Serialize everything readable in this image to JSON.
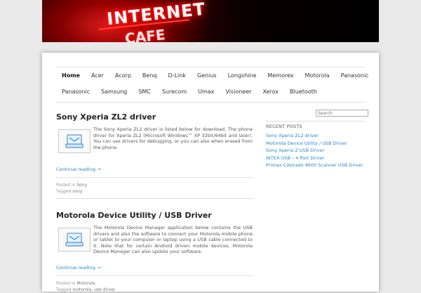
{
  "banner": {
    "neon_text": "INTERNET",
    "neon_text_2": "CAFE"
  },
  "nav": {
    "row1": [
      "Home",
      "Acer",
      "Acorp",
      "Benq",
      "D-Link",
      "Genius",
      "Longshine",
      "Memorex",
      "Motorola",
      "Panasonic"
    ],
    "row2": [
      "Panasonic",
      "Samsung",
      "SMC",
      "Surecom",
      "Umax",
      "Visioneer",
      "Xerox",
      "Bluetooth"
    ],
    "active": "Home"
  },
  "posts": [
    {
      "title": "Sony Xperia ZL2 driver",
      "excerpt": "The Sony Xperia ZL2 driver is listed below for download. The phone driver for Xperia ZL2 (Microsoft Windows™ XP 32bit/64bit and later). You can use drivers for debugging, or you can also when erased from the phone.",
      "continue": "Continue reading →",
      "posted_label": "Posted in",
      "category": "Sony",
      "tagged_label": "Tagged",
      "tags": "sony",
      "thumb_icon": "driver-install-icon"
    },
    {
      "title": "Motorola Device Utility / USB Driver",
      "excerpt": "The Motorola Device Manager application below contains the USB drivers and also the software to connect your Motorola mobile phone or tablet to your computer or laptop using a USB cable connected to it.  Note that for certain Android driven mobile devices, Motorola Device Manager can also update your software.",
      "continue": "Continue reading →",
      "posted_label": "Posted in",
      "category": "Motorola",
      "tagged_label": "Tagged",
      "tags": "motorola, usb driver",
      "thumb_icon": "driver-install-icon"
    }
  ],
  "sidebar": {
    "search_placeholder": "Search",
    "recent_title": "RECENT POSTS",
    "recent": [
      "Sony Xperia ZL2 driver",
      "Motorola Device Utility / USB Driver",
      "Sony Xperia Z USB Driver",
      "INTEX USB – 4 Port Driver",
      "Primax Colorado 9600 Scanner USB Driver"
    ]
  },
  "colors": {
    "link": "#2a86c8",
    "page_bg": "#e9e9e9"
  }
}
